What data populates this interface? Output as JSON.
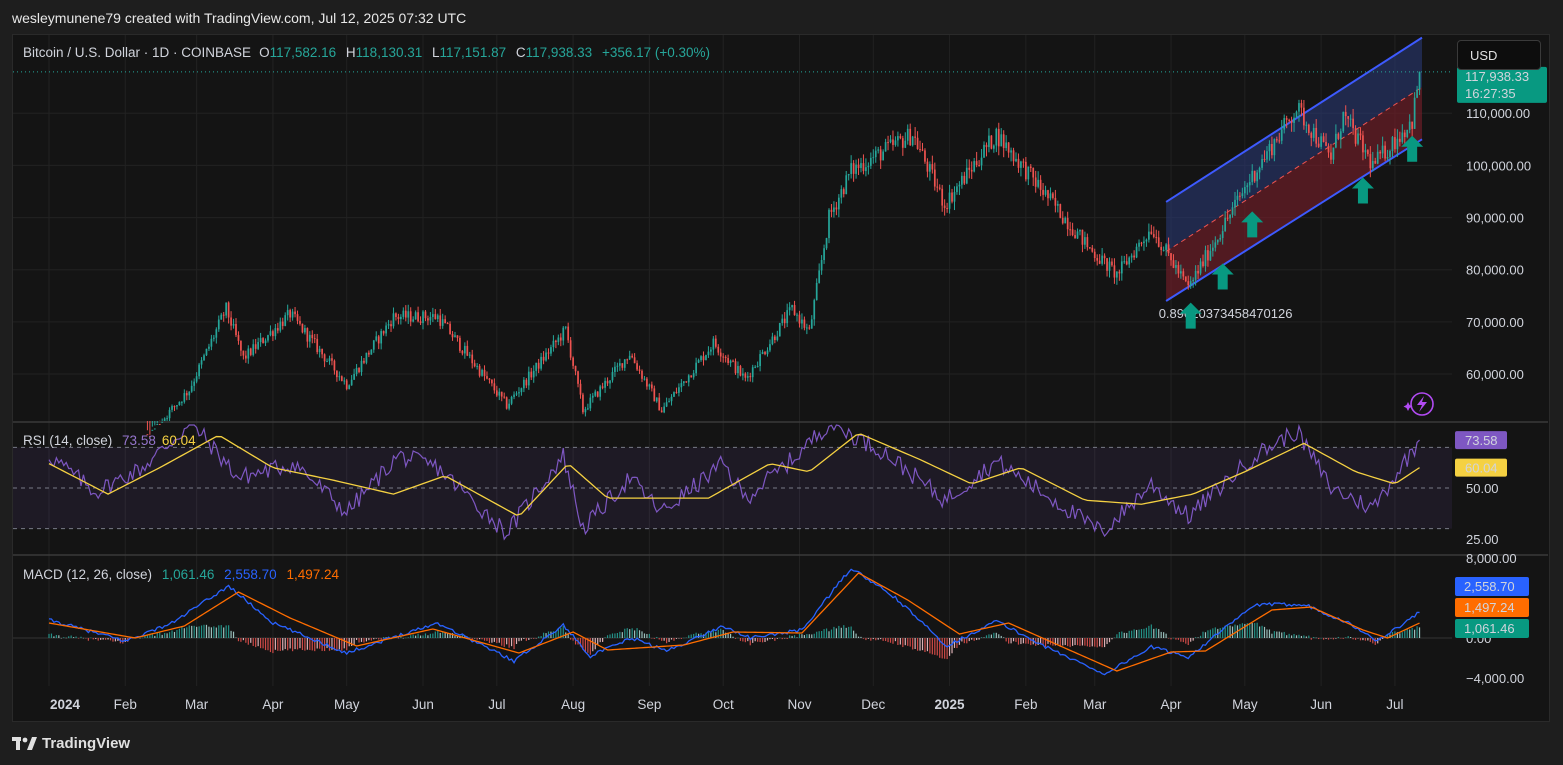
{
  "header": {
    "caption": "wesleymunene79 created with TradingView.com, Jul 12, 2025 07:32 UTC"
  },
  "price_legend": {
    "symbol": "Bitcoin / U.S. Dollar · 1D · COINBASE",
    "o_label": "O",
    "o_value": "117,582.16",
    "h_label": "H",
    "h_value": "118,130.31",
    "l_label": "L",
    "l_value": "117,151.87",
    "c_label": "C",
    "c_value": "117,938.33",
    "change": "+356.17 (+0.30%)"
  },
  "currency_button": "USD",
  "last_price_tag": {
    "price": "117,938.33",
    "countdown": "16:27:35"
  },
  "channel_annotation": "0.89020373458470126",
  "rsi_legend": {
    "label": "RSI (14, close)",
    "rsi": "73.58",
    "ma": "60.04"
  },
  "macd_legend": {
    "label": "MACD (12, 26, close)",
    "hist": "1,061.46",
    "macd": "2,558.70",
    "signal": "1,497.24"
  },
  "footer": {
    "brand": "TradingView"
  },
  "colors": {
    "up": "#26a69a",
    "down": "#ef5350",
    "rsi": "#7e57c2",
    "rsi_ma": "#f5d142",
    "macd": "#2962ff",
    "signal": "#ff6d00",
    "channel": "#3d5afe",
    "arrow": "#089981"
  },
  "chart_data": [
    {
      "type": "candlestick",
      "title": "Bitcoin / U.S. Dollar · 1D · COINBASE",
      "price_ticks": [
        "110,000.00",
        "100,000.00",
        "90,000.00",
        "80,000.00",
        "70,000.00",
        "60,000.00"
      ],
      "price_tick_values": [
        110000,
        100000,
        90000,
        80000,
        70000,
        60000
      ],
      "ylim": [
        51000,
        125000
      ],
      "x_ticks": [
        "2024",
        "Feb",
        "Mar",
        "Apr",
        "May",
        "Jun",
        "Jul",
        "Aug",
        "Sep",
        "Oct",
        "Nov",
        "Dec",
        "2025",
        "Feb",
        "Mar",
        "Apr",
        "May",
        "Jun",
        "Jul"
      ],
      "close_path": [
        {
          "date": "2024-01-01",
          "close": 45000
        },
        {
          "date": "2024-02-10",
          "close": 48000
        },
        {
          "date": "2024-02-27",
          "close": 57000
        },
        {
          "date": "2024-03-13",
          "close": 72500
        },
        {
          "date": "2024-03-20",
          "close": 63000
        },
        {
          "date": "2024-04-08",
          "close": 71500
        },
        {
          "date": "2024-05-01",
          "close": 58000
        },
        {
          "date": "2024-05-20",
          "close": 71000
        },
        {
          "date": "2024-06-07",
          "close": 71000
        },
        {
          "date": "2024-07-05",
          "close": 54000
        },
        {
          "date": "2024-07-29",
          "close": 68500
        },
        {
          "date": "2024-08-05",
          "close": 53000
        },
        {
          "date": "2024-08-24",
          "close": 64000
        },
        {
          "date": "2024-09-06",
          "close": 53000
        },
        {
          "date": "2024-09-27",
          "close": 66000
        },
        {
          "date": "2024-10-10",
          "close": 59000
        },
        {
          "date": "2024-10-29",
          "close": 72500
        },
        {
          "date": "2024-11-05",
          "close": 68000
        },
        {
          "date": "2024-11-13",
          "close": 90000
        },
        {
          "date": "2024-11-22",
          "close": 99000
        },
        {
          "date": "2024-12-17",
          "close": 106000
        },
        {
          "date": "2024-12-30",
          "close": 92500
        },
        {
          "date": "2025-01-20",
          "close": 106000
        },
        {
          "date": "2025-02-27",
          "close": 84000
        },
        {
          "date": "2025-03-10",
          "close": 79000
        },
        {
          "date": "2025-03-24",
          "close": 88000
        },
        {
          "date": "2025-04-08",
          "close": 76500
        },
        {
          "date": "2025-05-02",
          "close": 96500
        },
        {
          "date": "2025-05-22",
          "close": 111000
        },
        {
          "date": "2025-06-05",
          "close": 101500
        },
        {
          "date": "2025-06-10",
          "close": 109500
        },
        {
          "date": "2025-06-22",
          "close": 100000
        },
        {
          "date": "2025-07-08",
          "close": 108500
        },
        {
          "date": "2025-07-11",
          "close": 117938
        }
      ],
      "channel": {
        "upper": [
          {
            "date": "2025-03-30",
            "value": 93000
          },
          {
            "date": "2025-07-12",
            "value": 124500
          }
        ],
        "mid": [
          {
            "date": "2025-03-30",
            "value": 83500
          },
          {
            "date": "2025-07-12",
            "value": 115000
          }
        ],
        "lower": [
          {
            "date": "2025-03-30",
            "value": 74000
          },
          {
            "date": "2025-07-12",
            "value": 105000
          }
        ]
      },
      "up_arrows": [
        {
          "date": "2025-04-09",
          "value": 71000
        },
        {
          "date": "2025-04-22",
          "value": 78500
        },
        {
          "date": "2025-05-04",
          "value": 88500
        },
        {
          "date": "2025-06-18",
          "value": 95000
        },
        {
          "date": "2025-07-08",
          "value": 103000
        }
      ],
      "last_price": 117938.33
    },
    {
      "type": "line",
      "title": "RSI (14, close)",
      "ticks": [
        "50.00",
        "25.00"
      ],
      "tick_values": [
        50,
        25
      ],
      "levels": [
        70,
        50,
        30
      ],
      "ylim": [
        18,
        82
      ],
      "rsi": [
        {
          "date": "2024-01-01",
          "value": 66
        },
        {
          "date": "2024-01-20",
          "value": 48
        },
        {
          "date": "2024-02-08",
          "value": 60
        },
        {
          "date": "2024-02-28",
          "value": 82
        },
        {
          "date": "2024-03-18",
          "value": 55
        },
        {
          "date": "2024-04-10",
          "value": 62
        },
        {
          "date": "2024-05-01",
          "value": 38
        },
        {
          "date": "2024-05-22",
          "value": 66
        },
        {
          "date": "2024-06-07",
          "value": 60
        },
        {
          "date": "2024-07-05",
          "value": 28
        },
        {
          "date": "2024-07-28",
          "value": 66
        },
        {
          "date": "2024-08-05",
          "value": 30
        },
        {
          "date": "2024-08-24",
          "value": 55
        },
        {
          "date": "2024-09-06",
          "value": 38
        },
        {
          "date": "2024-10-01",
          "value": 62
        },
        {
          "date": "2024-10-10",
          "value": 45
        },
        {
          "date": "2024-10-30",
          "value": 65
        },
        {
          "date": "2024-11-13",
          "value": 82
        },
        {
          "date": "2024-12-05",
          "value": 68
        },
        {
          "date": "2024-12-30",
          "value": 44
        },
        {
          "date": "2025-01-20",
          "value": 63
        },
        {
          "date": "2025-02-10",
          "value": 46
        },
        {
          "date": "2025-03-04",
          "value": 28
        },
        {
          "date": "2025-03-24",
          "value": 52
        },
        {
          "date": "2025-04-08",
          "value": 36
        },
        {
          "date": "2025-05-05",
          "value": 66
        },
        {
          "date": "2025-05-22",
          "value": 78
        },
        {
          "date": "2025-06-05",
          "value": 50
        },
        {
          "date": "2025-06-22",
          "value": 40
        },
        {
          "date": "2025-07-11",
          "value": 73.58
        }
      ],
      "rsi_ma": [
        {
          "date": "2024-01-01",
          "value": 62
        },
        {
          "date": "2024-01-25",
          "value": 47
        },
        {
          "date": "2024-02-15",
          "value": 60
        },
        {
          "date": "2024-03-10",
          "value": 76
        },
        {
          "date": "2024-04-01",
          "value": 60
        },
        {
          "date": "2024-04-25",
          "value": 54
        },
        {
          "date": "2024-05-20",
          "value": 47
        },
        {
          "date": "2024-06-10",
          "value": 56
        },
        {
          "date": "2024-07-10",
          "value": 36
        },
        {
          "date": "2024-07-30",
          "value": 62
        },
        {
          "date": "2024-08-15",
          "value": 45
        },
        {
          "date": "2024-09-05",
          "value": 45
        },
        {
          "date": "2024-09-25",
          "value": 45
        },
        {
          "date": "2024-10-20",
          "value": 62
        },
        {
          "date": "2024-11-05",
          "value": 58
        },
        {
          "date": "2024-11-25",
          "value": 77
        },
        {
          "date": "2024-12-20",
          "value": 64
        },
        {
          "date": "2025-01-10",
          "value": 52
        },
        {
          "date": "2025-01-30",
          "value": 60
        },
        {
          "date": "2025-02-25",
          "value": 44
        },
        {
          "date": "2025-03-20",
          "value": 42
        },
        {
          "date": "2025-04-10",
          "value": 47
        },
        {
          "date": "2025-05-01",
          "value": 58
        },
        {
          "date": "2025-05-25",
          "value": 72
        },
        {
          "date": "2025-06-15",
          "value": 58
        },
        {
          "date": "2025-07-01",
          "value": 52
        },
        {
          "date": "2025-07-11",
          "value": 60.04
        }
      ],
      "last_rsi": 73.58,
      "last_ma": 60.04
    },
    {
      "type": "line",
      "title": "MACD (12, 26, close)",
      "ticks": [
        "8,000.00",
        "0.00",
        "−4,000.00"
      ],
      "tick_values": [
        8000,
        0,
        -4000
      ],
      "ylim": [
        -4800,
        8200
      ],
      "macd": [
        {
          "date": "2024-01-01",
          "value": 1800
        },
        {
          "date": "2024-02-01",
          "value": -300
        },
        {
          "date": "2024-02-20",
          "value": 1500
        },
        {
          "date": "2024-03-14",
          "value": 5200
        },
        {
          "date": "2024-04-01",
          "value": 1500
        },
        {
          "date": "2024-05-01",
          "value": -1500
        },
        {
          "date": "2024-05-25",
          "value": 500
        },
        {
          "date": "2024-06-07",
          "value": 1500
        },
        {
          "date": "2024-07-08",
          "value": -2300
        },
        {
          "date": "2024-07-28",
          "value": 1300
        },
        {
          "date": "2024-08-08",
          "value": -1800
        },
        {
          "date": "2024-08-25",
          "value": 0
        },
        {
          "date": "2024-09-08",
          "value": -1300
        },
        {
          "date": "2024-10-01",
          "value": 1200
        },
        {
          "date": "2024-10-12",
          "value": 0
        },
        {
          "date": "2024-11-02",
          "value": 800
        },
        {
          "date": "2024-11-22",
          "value": 7000
        },
        {
          "date": "2024-12-10",
          "value": 4000
        },
        {
          "date": "2024-12-31",
          "value": -800
        },
        {
          "date": "2025-01-20",
          "value": 1700
        },
        {
          "date": "2025-02-10",
          "value": -1000
        },
        {
          "date": "2025-03-05",
          "value": -3600
        },
        {
          "date": "2025-03-24",
          "value": -900
        },
        {
          "date": "2025-04-08",
          "value": -1900
        },
        {
          "date": "2025-05-05",
          "value": 3300
        },
        {
          "date": "2025-05-25",
          "value": 3400
        },
        {
          "date": "2025-06-12",
          "value": 1500
        },
        {
          "date": "2025-06-24",
          "value": -300
        },
        {
          "date": "2025-07-11",
          "value": 2558.7
        }
      ],
      "signal": [
        {
          "date": "2024-01-01",
          "value": 1500
        },
        {
          "date": "2024-02-05",
          "value": 0
        },
        {
          "date": "2024-02-25",
          "value": 1200
        },
        {
          "date": "2024-03-18",
          "value": 4600
        },
        {
          "date": "2024-04-08",
          "value": 2000
        },
        {
          "date": "2024-05-05",
          "value": -800
        },
        {
          "date": "2024-06-05",
          "value": 900
        },
        {
          "date": "2024-07-10",
          "value": -1500
        },
        {
          "date": "2024-08-01",
          "value": 600
        },
        {
          "date": "2024-08-15",
          "value": -1200
        },
        {
          "date": "2024-09-15",
          "value": -700
        },
        {
          "date": "2024-10-05",
          "value": 600
        },
        {
          "date": "2024-11-02",
          "value": 500
        },
        {
          "date": "2024-11-25",
          "value": 6500
        },
        {
          "date": "2024-12-15",
          "value": 3800
        },
        {
          "date": "2025-01-05",
          "value": 400
        },
        {
          "date": "2025-01-25",
          "value": 1500
        },
        {
          "date": "2025-02-15",
          "value": -800
        },
        {
          "date": "2025-03-10",
          "value": -3300
        },
        {
          "date": "2025-04-01",
          "value": -1400
        },
        {
          "date": "2025-04-15",
          "value": -1300
        },
        {
          "date": "2025-05-12",
          "value": 2800
        },
        {
          "date": "2025-05-28",
          "value": 3100
        },
        {
          "date": "2025-06-18",
          "value": 800
        },
        {
          "date": "2025-06-28",
          "value": 0
        },
        {
          "date": "2025-07-11",
          "value": 1497.24
        }
      ],
      "last_macd": 2558.7,
      "last_signal": 1497.24,
      "last_hist": 1061.46
    }
  ]
}
